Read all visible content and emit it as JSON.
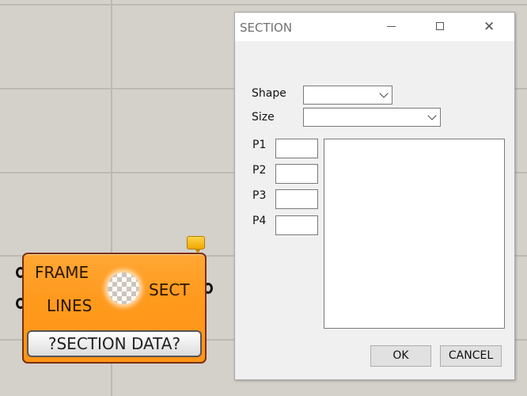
{
  "canvas": {
    "component": {
      "inputs": [
        "FRAME",
        "LINES"
      ],
      "output": "SECT",
      "button_label": "?SECTION DATA?",
      "body_color": "#ff9a1e",
      "balloon_color": "#f5b800"
    }
  },
  "dialog": {
    "title": "SECTION",
    "window_controls": {
      "minimize": "minimize-icon",
      "maximize": "maximize-icon",
      "close": "close-icon"
    },
    "close_glyph": "✕",
    "shape": {
      "label": "Shape",
      "value": ""
    },
    "size": {
      "label": "Size",
      "value": ""
    },
    "params": [
      {
        "label": "P1",
        "value": ""
      },
      {
        "label": "P2",
        "value": ""
      },
      {
        "label": "P3",
        "value": ""
      },
      {
        "label": "P4",
        "value": ""
      }
    ],
    "output_text": "",
    "ok_label": "OK",
    "cancel_label": "CANCEL"
  }
}
